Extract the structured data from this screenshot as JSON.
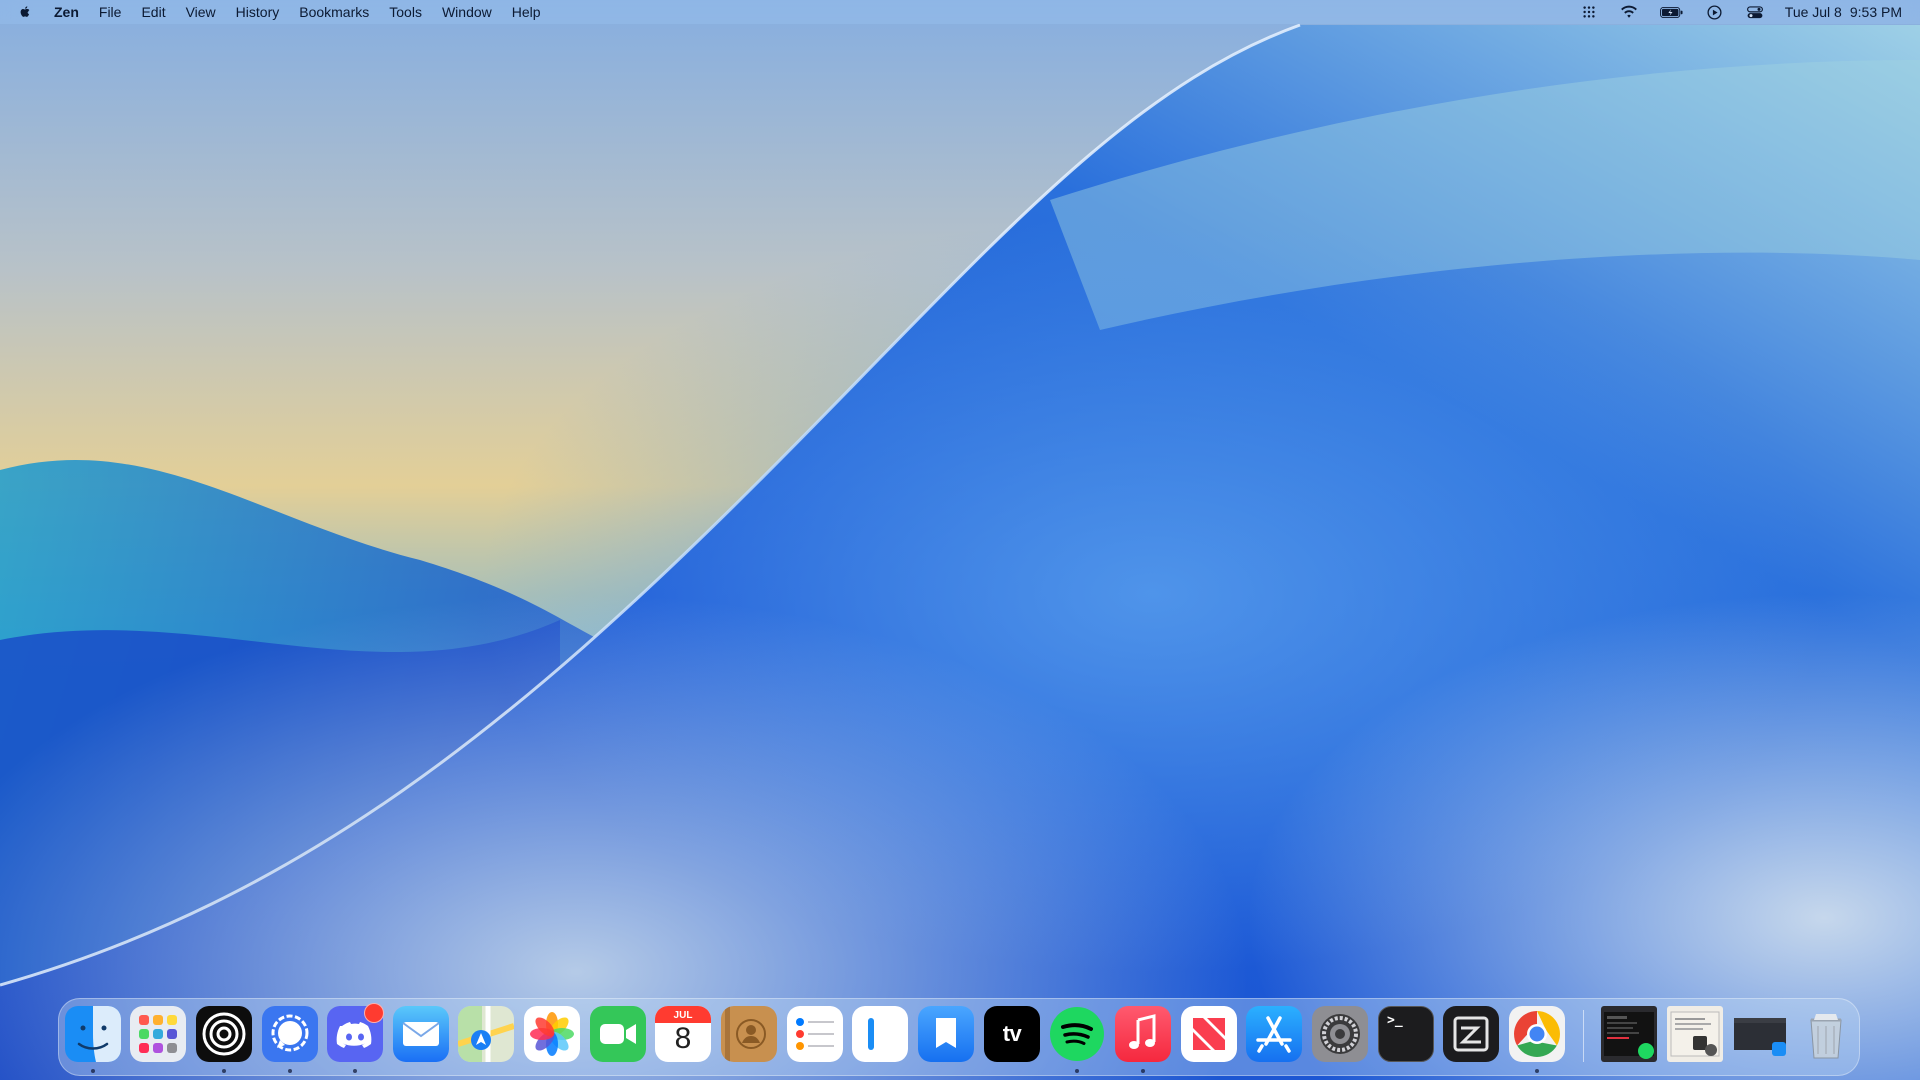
{
  "menubar": {
    "app_name": "Zen",
    "menus": [
      "File",
      "Edit",
      "View",
      "History",
      "Bookmarks",
      "Tools",
      "Window",
      "Help"
    ],
    "status_icons": [
      "control-strip-icon",
      "wifi-icon",
      "battery-icon",
      "now-playing-icon",
      "control-center-icon"
    ],
    "date": "Tue Jul 8",
    "time": "9:53 PM"
  },
  "dock": {
    "apps": [
      {
        "name": "Finder",
        "icon": "finder-icon",
        "running": true
      },
      {
        "name": "Launchpad",
        "icon": "launchpad-icon",
        "running": false
      },
      {
        "name": "Zen",
        "icon": "zen-browser-icon",
        "running": true
      },
      {
        "name": "Signal",
        "icon": "signal-icon",
        "running": true
      },
      {
        "name": "Discord",
        "icon": "discord-icon",
        "running": true,
        "badge": true
      },
      {
        "name": "Mail",
        "icon": "mail-icon",
        "running": false
      },
      {
        "name": "Maps",
        "icon": "maps-icon",
        "running": false
      },
      {
        "name": "Photos",
        "icon": "photos-icon",
        "running": false
      },
      {
        "name": "FaceTime",
        "icon": "facetime-icon",
        "running": false
      },
      {
        "name": "Calendar",
        "icon": "calendar-icon",
        "running": false,
        "month": "JUL",
        "day": "8"
      },
      {
        "name": "Contacts",
        "icon": "contacts-icon",
        "running": false
      },
      {
        "name": "Reminders",
        "icon": "reminders-icon",
        "running": false
      },
      {
        "name": "Notes App",
        "icon": "notes-icon",
        "running": false
      },
      {
        "name": "Books",
        "icon": "books-icon",
        "running": false
      },
      {
        "name": "TV",
        "icon": "apple-tv-icon",
        "running": false,
        "label": "tv"
      },
      {
        "name": "Spotify",
        "icon": "spotify-icon",
        "running": true
      },
      {
        "name": "Music",
        "icon": "music-icon",
        "running": true
      },
      {
        "name": "News",
        "icon": "news-icon",
        "running": false
      },
      {
        "name": "App Store",
        "icon": "app-store-icon",
        "running": false
      },
      {
        "name": "System Settings",
        "icon": "system-settings-icon",
        "running": false
      },
      {
        "name": "Terminal",
        "icon": "terminal-icon",
        "running": false,
        "prompt": ">_"
      },
      {
        "name": "Zed",
        "icon": "zed-editor-icon",
        "running": false
      },
      {
        "name": "Chrome",
        "icon": "chrome-icon",
        "running": true
      }
    ],
    "stacks": [
      {
        "icon": "minimized-window-spotify-icon"
      },
      {
        "icon": "minimized-window-document-icon"
      },
      {
        "icon": "minimized-window-finder-icon"
      },
      {
        "icon": "trash-icon"
      }
    ]
  },
  "colors": {
    "wallpaper_blue": "#1b4fd0",
    "wallpaper_sand": "#e5cf95",
    "badge_red": "#ff3b30"
  }
}
